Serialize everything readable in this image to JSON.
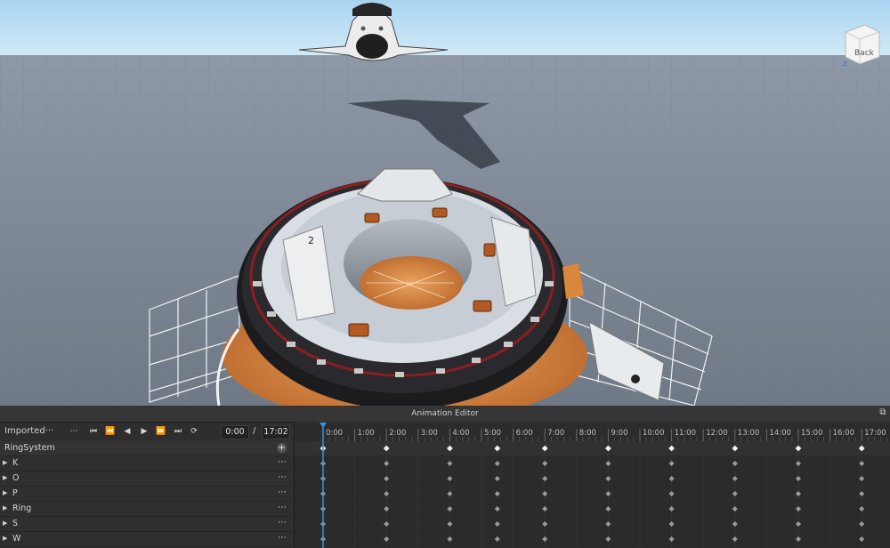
{
  "viewport": {
    "view_cube_label": "Back",
    "view_cube_axis": "Z",
    "ring_marker_label": "2"
  },
  "editor": {
    "title": "Animation Editor",
    "restore_icon": "restore-window-icon",
    "animation_name": "Imported···",
    "controls": [
      {
        "name": "more-options-icon",
        "glyph": "⋯"
      },
      {
        "name": "skip-to-start-icon",
        "glyph": "⏮"
      },
      {
        "name": "previous-keyframe-icon",
        "glyph": "⏪"
      },
      {
        "name": "play-reverse-icon",
        "glyph": "◀"
      },
      {
        "name": "play-icon",
        "glyph": "▶"
      },
      {
        "name": "next-keyframe-icon",
        "glyph": "⏩"
      },
      {
        "name": "skip-to-end-icon",
        "glyph": "⏭"
      },
      {
        "name": "loop-icon",
        "glyph": "⟳"
      }
    ],
    "current_time": "0:00",
    "time_separator": "/",
    "end_time": "17:02",
    "tracks": [
      {
        "label": "RingSystem",
        "root": true
      },
      {
        "label": "K"
      },
      {
        "label": "O"
      },
      {
        "label": "P"
      },
      {
        "label": "Ring"
      },
      {
        "label": "S"
      },
      {
        "label": "W"
      }
    ],
    "timeline": {
      "ticks": [
        "0:00",
        "1:00",
        "2:00",
        "3:00",
        "4:00",
        "5:00",
        "6:00",
        "7:00",
        "8:00",
        "9:00",
        "10:00",
        "11:00",
        "12:00",
        "13:00",
        "14:00",
        "15:00",
        "16:00",
        "17:00"
      ],
      "keyframe_ticks": [
        0,
        2,
        4,
        5.5,
        7,
        9,
        11,
        13,
        15,
        17
      ],
      "playhead": 0,
      "colors": {
        "playhead": "#3a8fe8",
        "keyframe_root": "#f2f2f2",
        "keyframe_child": "#9a9a9a"
      }
    }
  }
}
